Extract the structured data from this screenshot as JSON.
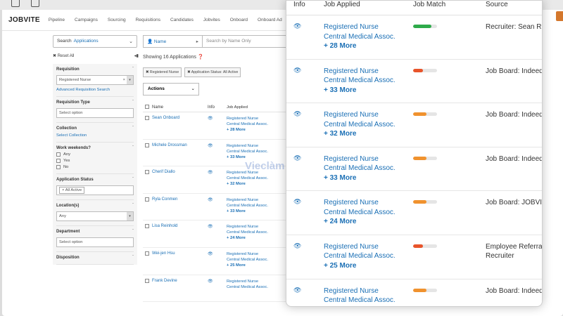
{
  "app": {
    "logo": "JOBVITE",
    "nav": [
      "Pipeline",
      "Campaigns",
      "Sourcing",
      "Requisitions",
      "Candidates",
      "Jobvites",
      "Onboard",
      "Onboard Ad"
    ]
  },
  "left_panel": {
    "search_label": "Search",
    "search_value": "Applications",
    "reset_all": "Reset All",
    "sections": {
      "requisition": {
        "title": "Requisition",
        "value": "Registered Nurse",
        "link": "Advanced Requisition Search"
      },
      "requisition_type": {
        "title": "Requisition Type",
        "placeholder": "Select option"
      },
      "collection": {
        "title": "Collection",
        "link": "Select Collection"
      },
      "work_weekends": {
        "title": "Work weekends?",
        "options": [
          "Any",
          "Yes",
          "No"
        ]
      },
      "application_status": {
        "title": "Application Status",
        "chip": "All Active"
      },
      "locations": {
        "title": "Location(s)",
        "value": "Any"
      },
      "department": {
        "title": "Department",
        "placeholder": "Select option"
      },
      "disposition": {
        "title": "Disposition"
      }
    }
  },
  "main": {
    "name_select": "Name",
    "search_placeholder": "Search by Name Only",
    "showing": "Showing 16 Applications",
    "tags": [
      "Registered Nurse",
      "Application Status: All Active"
    ],
    "actions_label": "Actions",
    "columns": [
      "Name",
      "Info",
      "Job Applied"
    ],
    "rows": [
      {
        "name": "Sean Onboard",
        "job1": "Registered Nurse",
        "job2": "Central Medical Assoc.",
        "more": "+ 28 More"
      },
      {
        "name": "Michele Drossman",
        "job1": "Registered Nurse",
        "job2": "Central Medical Assoc.",
        "more": "+ 33 More"
      },
      {
        "name": "Cherif Diallo",
        "job1": "Registered Nurse",
        "job2": "Central Medical Assoc.",
        "more": "+ 32 More"
      },
      {
        "name": "Ryla Conmen",
        "job1": "Registered Nurse",
        "job2": "Central Medical Assoc.",
        "more": "+ 33 More"
      },
      {
        "name": "Lisa Reinhold",
        "job1": "Registered Nurse",
        "job2": "Central Medical Assoc.",
        "more": "+ 24 More"
      },
      {
        "name": "Wei-jen Hsu",
        "job1": "Registered Nurse",
        "job2": "Central Medical Assoc.",
        "more": "+ 25 More"
      },
      {
        "name": "Frank Devine",
        "job1": "Registered Nurse",
        "job2": "Central Medical Assoc.",
        "more": ""
      }
    ]
  },
  "watermark": "Vieclàm",
  "overlay": {
    "columns": [
      "Info",
      "Job Applied",
      "Job Match",
      "Source"
    ],
    "rows": [
      {
        "job1": "Registered Nurse",
        "job2": "Central Medical Assoc.",
        "more": "+ 28 More",
        "match": 0.75,
        "match_color": "#2eaa4a",
        "source1": "Recruiter: Sean Re",
        "source2": ""
      },
      {
        "job1": "Registered Nurse",
        "job2": "Central Medical Assoc.",
        "more": "+ 33 More",
        "match": 0.4,
        "match_color": "#e8542a",
        "source1": "Job Board: Indeed",
        "source2": ""
      },
      {
        "job1": "Registered Nurse",
        "job2": "Central Medical Assoc.",
        "more": "+ 32 More",
        "match": 0.55,
        "match_color": "#f0922e",
        "source1": "Job Board: Indeed",
        "source2": ""
      },
      {
        "job1": "Registered Nurse",
        "job2": "Central Medical Assoc.",
        "more": "+ 33 More",
        "match": 0.55,
        "match_color": "#f0922e",
        "source1": "Job Board: Indeed",
        "source2": ""
      },
      {
        "job1": "Registered Nurse",
        "job2": "Central Medical Assoc.",
        "more": "+ 24 More",
        "match": 0.55,
        "match_color": "#f0922e",
        "source1": "Job Board: JOBVITE",
        "source2": ""
      },
      {
        "job1": "Registered Nurse",
        "job2": "Central Medical Assoc.",
        "more": "+ 25 More",
        "match": 0.4,
        "match_color": "#e8542a",
        "source1": "Employee Referral",
        "source2": "Recruiter"
      },
      {
        "job1": "Registered Nurse",
        "job2": "Central Medical Assoc.",
        "more": "",
        "match": 0.55,
        "match_color": "#f0922e",
        "source1": "Job Board: Indeed",
        "source2": ""
      }
    ]
  },
  "icons": {
    "eye": "eye-icon",
    "close": "close-icon",
    "chevron": "chevron-down-icon",
    "user": "user-icon",
    "help": "help-icon",
    "pin": "pin-icon"
  }
}
